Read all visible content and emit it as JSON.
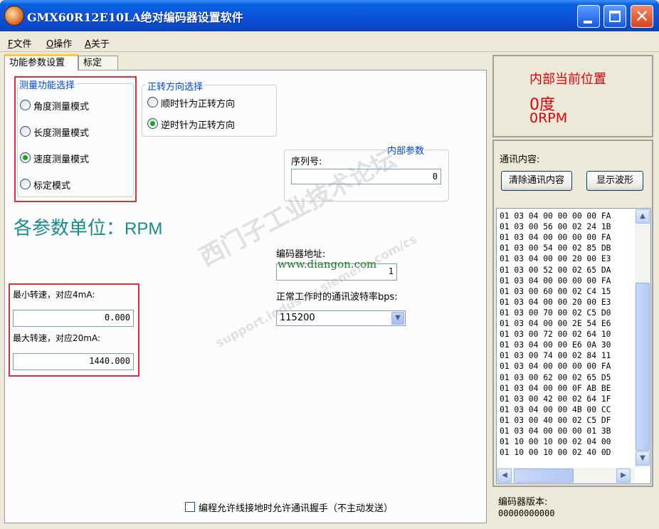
{
  "window": {
    "title": "GMX60R12E10LA绝对编码器设置软件"
  },
  "menu": [
    {
      "key": "F",
      "label": "文件"
    },
    {
      "key": "O",
      "label": "操作"
    },
    {
      "key": "A",
      "label": "关于"
    }
  ],
  "tabs": [
    "功能参数设置",
    "标定"
  ],
  "measure_group": {
    "title": "测量功能选择",
    "options": [
      {
        "label": "角度测量模式",
        "checked": false
      },
      {
        "label": "长度测量模式",
        "checked": false
      },
      {
        "label": "速度测量模式",
        "checked": true
      },
      {
        "label": "标定模式",
        "checked": false
      }
    ]
  },
  "direction_group": {
    "title": "正转方向选择",
    "options": [
      {
        "label": "顺时针为正转方向",
        "checked": false
      },
      {
        "label": "逆时针为正转方向",
        "checked": true
      }
    ]
  },
  "internal_params": {
    "title": "内部参数",
    "serial_label": "序列号:",
    "serial_value": "0"
  },
  "units": {
    "label": "各参数单位：",
    "value": "RPM"
  },
  "speed_range": {
    "min_label": "最小转速，对应4mA:",
    "min_value": "0.000",
    "max_label": "最大转速，对应20mA:",
    "max_value": "1440.000"
  },
  "encoder_address": {
    "label": "编码器地址:",
    "value": "1"
  },
  "baud": {
    "label": "正常工作时的通讯波特率bps:",
    "value": "115200"
  },
  "handshake": {
    "label": "编程允许线接地时允许通讯握手（不主动发送）",
    "checked": false
  },
  "position_panel": {
    "title": "内部当前位置",
    "angle": "0度",
    "speed": "0RPM",
    "color": "#e0000a"
  },
  "comm": {
    "title": "通讯内容:",
    "clear_button": "清除通讯内容",
    "wave_button": "显示波形",
    "lines": [
      "01 03 04 00 00 00 00 FA",
      "01 03 00 56 00 02 24 1B",
      "01 03 04 00 00 00 00 FA",
      "01 03 00 54 00 02 85 DB",
      "01 03 04 00 00 20 00 E3",
      "01 03 00 52 00 02 65 DA",
      "01 03 04 00 00 00 00 FA",
      "01 03 00 60 00 02 C4 15",
      "01 03 04 00 00 20 00 E3",
      "01 03 00 70 00 02 C5 D0",
      "01 03 04 00 00 2E 54 E6",
      "01 03 00 72 00 02 64 10",
      "01 03 04 00 00 E6 0A 30",
      "01 03 00 74 00 02 84 11",
      "01 03 04 00 00 00 00 FA",
      "01 03 00 62 00 02 65 D5",
      "01 03 04 00 00 0F AB BE",
      "01 03 00 42 00 02 64 1F",
      "01 03 04 00 00 4B 00 CC",
      "01 03 00 40 00 02 C5 DF",
      "01 03 04 00 00 00 01 3B",
      "01 10 00 10 00 02 04 00",
      "01 10 00 10 00 02 40 0D"
    ]
  },
  "version": {
    "label": "编码器版本:",
    "value": "00000000000"
  },
  "watermarks": {
    "site": "www.diangon.com",
    "forum": "西门子工业技术论坛",
    "url": "support.industry.siemens.com/cs"
  },
  "colors": {
    "accent_teal": "#1a8a8a",
    "red_highlight": "#d9333a",
    "group_blue": "#0046d5"
  }
}
